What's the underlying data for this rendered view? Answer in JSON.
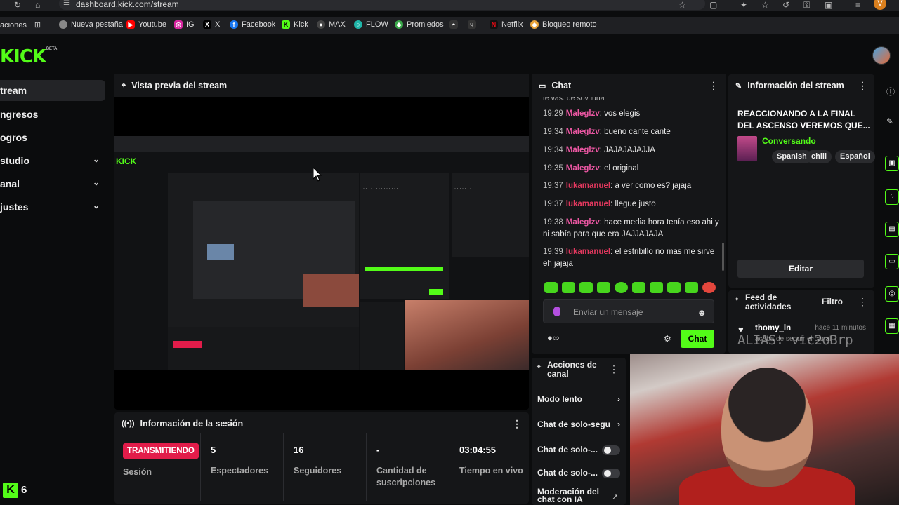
{
  "browser": {
    "url": "dashboard.kick.com/stream",
    "profile_initial": "V"
  },
  "bookmarks": [
    {
      "label": "aciones",
      "icon": "apps-icon",
      "color": "#1f2023"
    },
    {
      "label": "Nueva pestaña",
      "icon": "nueva-pestana-icon",
      "color": "#888888"
    },
    {
      "label": "Youtube",
      "icon": "youtube-icon",
      "color": "#ff0000"
    },
    {
      "label": "IG",
      "icon": "instagram-icon",
      "color": "#d6249f"
    },
    {
      "label": "X",
      "icon": "x-icon",
      "color": "#000000"
    },
    {
      "label": "Facebook",
      "icon": "facebook-icon",
      "color": "#1877f2"
    },
    {
      "label": "Kick",
      "icon": "kick-icon",
      "color": "#53fc18"
    },
    {
      "label": "MAX",
      "icon": "max-icon",
      "color": "#444444"
    },
    {
      "label": "FLOW",
      "icon": "flow-icon",
      "color": "#1fb5a8"
    },
    {
      "label": "Promiedos",
      "icon": "promiedos-icon",
      "color": "#3aa84a"
    },
    {
      "label": "Netflix",
      "icon": "netflix-icon",
      "color": "#e50914"
    },
    {
      "label": "Bloqueo remoto",
      "icon": "bloqueo-icon",
      "color": "#e8a33a"
    }
  ],
  "logo": {
    "text": "KICK",
    "beta": "BETA"
  },
  "sidebar": {
    "items": [
      {
        "label": "tream",
        "active": true,
        "chevron": ""
      },
      {
        "label": "ngresos",
        "active": false,
        "chevron": ""
      },
      {
        "label": "ogros",
        "active": false,
        "chevron": ""
      },
      {
        "label": "studio",
        "active": false,
        "chevron": "⌄"
      },
      {
        "label": "anal",
        "active": false,
        "chevron": "⌄"
      },
      {
        "label": "justes",
        "active": false,
        "chevron": "⌄"
      }
    ]
  },
  "preview": {
    "title": "Vista previa del stream"
  },
  "session": {
    "title": "Información de la sesión",
    "live_badge": "TRANSMITIENDO",
    "session_label": "Sesión",
    "stats": [
      {
        "value": "5",
        "label": "Espectadores"
      },
      {
        "value": "16",
        "label": "Seguidores"
      },
      {
        "value": "-",
        "label": "Cantidad de suscripciones"
      },
      {
        "value": "03:04:55",
        "label": "Tiempo en vivo"
      }
    ]
  },
  "chat": {
    "title": "Chat",
    "top_fragment": "te vas, de soy luna",
    "messages": [
      {
        "time": "19:29",
        "user": "Maleglzv",
        "text": ": vos elegis",
        "style": "u1"
      },
      {
        "time": "19:34",
        "user": "Maleglzv",
        "text": ": bueno cante cante",
        "style": "u1"
      },
      {
        "time": "19:34",
        "user": "Maleglzv",
        "text": ": JAJAJAJAJJA",
        "style": "u1"
      },
      {
        "time": "19:35",
        "user": "Maleglzv",
        "text": ": el original",
        "style": "u1"
      },
      {
        "time": "19:37",
        "user": "lukamanuel",
        "text": ": a ver como es? jajaja",
        "style": "u2"
      },
      {
        "time": "19:37",
        "user": "lukamanuel",
        "text": ": llegue justo",
        "style": "u2"
      },
      {
        "time": "19:38",
        "user": "Maleglzv",
        "text": ": hace media hora tenía eso ahi y ni sabía para que era JAJJAJAJA",
        "style": "u1"
      },
      {
        "time": "19:39",
        "user": "lukamanuel",
        "text": ": el estribillo no mas me sirve eh jajaja",
        "style": "u2"
      }
    ],
    "input_placeholder": "Enviar un mensaje",
    "send_label": "Chat"
  },
  "stream_info": {
    "title": "Información del stream",
    "stream_title": "REACCIONANDO A LA FINAL DEL ASCENSO VEREMOS QUE...",
    "category": "Conversando",
    "tags": [
      "Spanish",
      "chill",
      "Español"
    ],
    "edit_label": "Editar"
  },
  "feed": {
    "title": "Feed de actividades",
    "filter_label": "Filtro",
    "user": "thomy_ln",
    "time": "hace 11 minutos",
    "action": "acaba de seguir el canal"
  },
  "actions": {
    "title": "Acciones de canal",
    "items": [
      {
        "label": "Modo lento",
        "control": "arrow"
      },
      {
        "label": "Chat de solo-segu",
        "control": "arrow"
      },
      {
        "label": "Chat de solo-...",
        "control": "toggle"
      },
      {
        "label": "Chat de solo-...",
        "control": "toggle"
      },
      {
        "label": "Moderación del chat con IA",
        "control": "link"
      }
    ]
  },
  "watermark": "ALIAS: vic2oBrp",
  "viewer_count": "6"
}
